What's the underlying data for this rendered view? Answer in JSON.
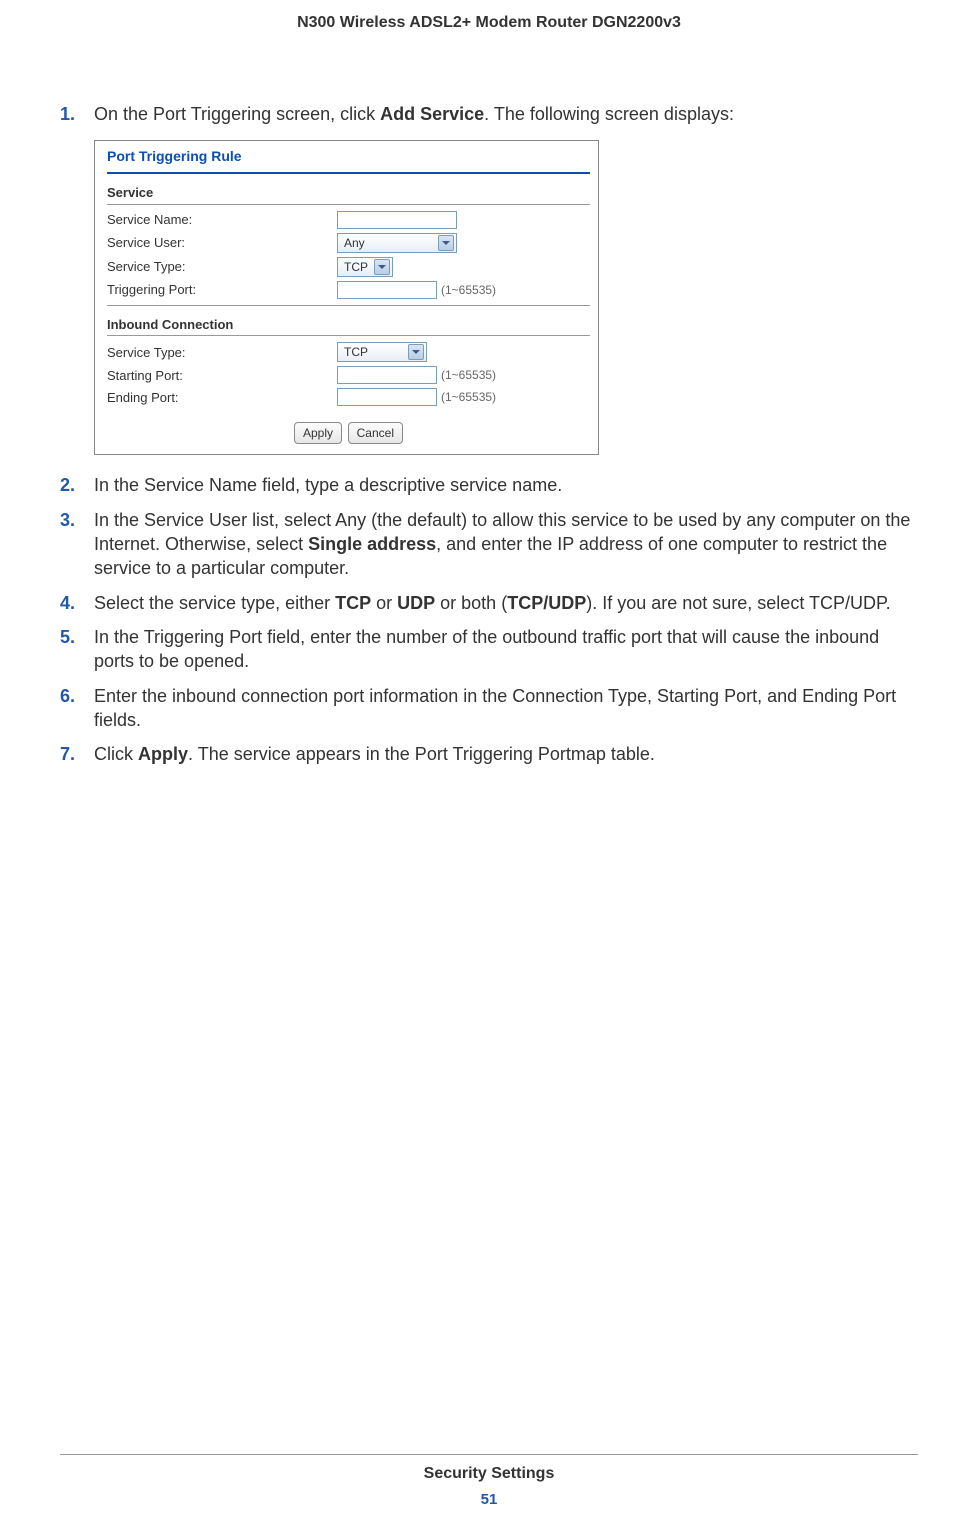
{
  "header": {
    "title": "N300 Wireless ADSL2+ Modem Router DGN2200v3"
  },
  "screenshot": {
    "title": "Port Triggering Rule",
    "service_section": "Service",
    "labels": {
      "service_name": "Service Name:",
      "service_user": "Service User:",
      "service_type": "Service Type:",
      "triggering_port": "Triggering Port:"
    },
    "values": {
      "service_user": "Any",
      "service_type": "TCP",
      "port_hint": "(1~65535)"
    },
    "inbound_section": "Inbound Connection",
    "inbound_labels": {
      "service_type": "Service Type:",
      "starting_port": "Starting Port:",
      "ending_port": "Ending Port:"
    },
    "inbound_values": {
      "service_type": "TCP"
    },
    "buttons": {
      "apply": "Apply",
      "cancel": "Cancel"
    }
  },
  "steps": {
    "n1": "1.",
    "s1a": "On the Port Triggering screen, click ",
    "s1b": "Add Service",
    "s1c": ". The following screen displays:",
    "n2": "2.",
    "s2": "In the Service Name field, type a descriptive service name.",
    "n3": "3.",
    "s3a": "In the Service User list, select Any (the default) to allow this service to be used by any computer on the Internet. Otherwise, select ",
    "s3b": "Single address",
    "s3c": ", and enter the IP address of one computer to restrict the service to a particular computer.",
    "n4": "4.",
    "s4a": "Select the service type, either ",
    "s4b": "TCP",
    "s4c": " or ",
    "s4d": "UDP",
    "s4e": " or both (",
    "s4f": "TCP/UDP",
    "s4g": "). If you are not sure, select TCP/UDP.",
    "n5": "5.",
    "s5": "In the Triggering Port field, enter the number of the outbound traffic port that will cause the inbound ports to be opened.",
    "n6": "6.",
    "s6": "Enter the inbound connection port information in the Connection Type, Starting Port, and Ending Port fields.",
    "n7": "7.",
    "s7a": "Click ",
    "s7b": "Apply",
    "s7c": ". The service appears in the Port Triggering Portmap table."
  },
  "footer": {
    "section": "Security Settings",
    "page": "51"
  }
}
